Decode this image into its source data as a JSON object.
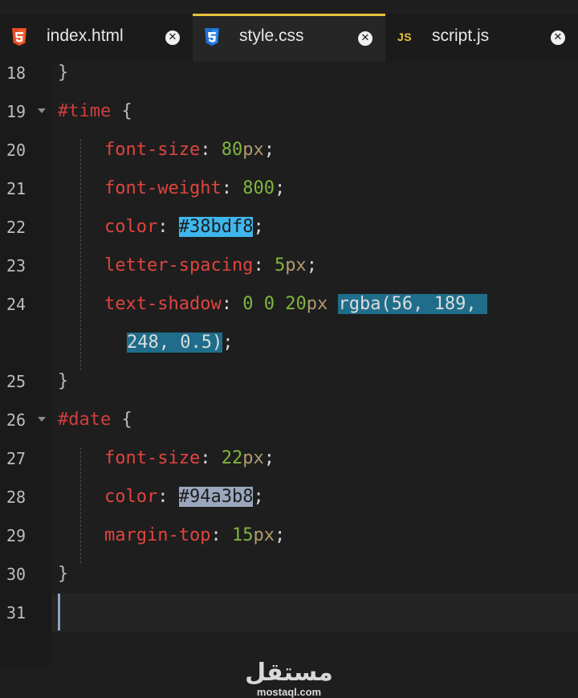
{
  "tabs": [
    {
      "label": "index.html",
      "icon": "html5-icon",
      "active": false
    },
    {
      "label": "style.css",
      "icon": "css3-icon",
      "active": true
    },
    {
      "label": "script.js",
      "icon": "js-icon",
      "badge": "JS",
      "active": false
    }
  ],
  "editor": {
    "lines": [
      {
        "n": "18",
        "text": "}"
      },
      {
        "n": "19",
        "text": "#time {"
      },
      {
        "n": "20",
        "text": "font-size: 80px;"
      },
      {
        "n": "21",
        "text": "font-weight: 800;"
      },
      {
        "n": "22",
        "text": "color: #38bdf8;"
      },
      {
        "n": "23",
        "text": "letter-spacing: 5px;"
      },
      {
        "n": "24",
        "text": "text-shadow: 0 0 20px rgba(56, 189, 248, 0.5);"
      },
      {
        "n": "25",
        "text": "}"
      },
      {
        "n": "26",
        "text": "#date {"
      },
      {
        "n": "27",
        "text": "font-size: 22px;"
      },
      {
        "n": "28",
        "text": "color: #94a3b8;"
      },
      {
        "n": "29",
        "text": "margin-top: 15px;"
      },
      {
        "n": "30",
        "text": "}"
      },
      {
        "n": "31",
        "text": ""
      }
    ],
    "tokens": {
      "brace_close": "}",
      "brace_open": "{",
      "sel_time": "#time",
      "sel_date": "#date",
      "p_font_size": "font-size",
      "p_font_weight": "font-weight",
      "p_color": "color",
      "p_letter_spacing": "letter-spacing",
      "p_text_shadow": "text-shadow",
      "p_margin_top": "margin-top",
      "colon": ":",
      "semicolon": ";",
      "px": "px",
      "v80": "80",
      "v800": "800",
      "v5": "5",
      "v0a": "0",
      "v0b": "0",
      "v20": "20",
      "v22": "22",
      "v15": "15",
      "hex_time": "#38bdf8",
      "rgba_part1": "rgba(56, 189,",
      "rgba_part2": "248, 0.5)",
      "hex_date": "#94a3b8"
    },
    "colors": {
      "selector": "#cf3e3e",
      "property": "#e0443e",
      "number": "#7fb640",
      "unit": "#b09a6e",
      "highlight_time": "#3fb6ec",
      "highlight_rgba": "#1f6d8a",
      "highlight_date": "#9aa7bd",
      "active_tab_accent": "#e8c33b"
    }
  },
  "watermark": {
    "arabic": "مستقل",
    "domain": "mostaql.com"
  }
}
